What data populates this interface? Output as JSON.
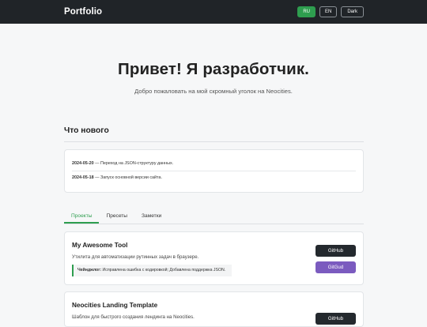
{
  "header": {
    "brand": "Portfolio",
    "lang_ru": "RU",
    "lang_en": "EN",
    "theme_toggle": "Dark",
    "accent": "#2e9e4f",
    "bg": "#202428"
  },
  "hero": {
    "title": "Привет! Я разработчик.",
    "subtitle": "Добро пожаловать на мой скромный уголок на Neocities."
  },
  "news": {
    "title": "Что нового",
    "items": [
      {
        "date": "2024-05-20",
        "text": " — Переход на JSON-структуру данных."
      },
      {
        "date": "2024-05-18",
        "text": " — Запуск основной версии сайта."
      }
    ]
  },
  "tabs": [
    {
      "label": "Проекты",
      "active": true
    },
    {
      "label": "Пресеты",
      "active": false
    },
    {
      "label": "Заметки",
      "active": false
    }
  ],
  "projects": [
    {
      "title": "My Awesome Tool",
      "description": "Утилита для автоматизации рутинных задач в браузере.",
      "changelog_label": "Чейнджлог:",
      "changelog_text": " Исправлена ошибка с кодировкой; Добавлена поддержка JSON.",
      "buttons": [
        "GitHub",
        "GitGud"
      ]
    },
    {
      "title": "Neocities Landing Template",
      "description": "Шаблон для быстрого создания лендинга на Neocities.",
      "buttons": [
        "GitHub"
      ]
    }
  ]
}
